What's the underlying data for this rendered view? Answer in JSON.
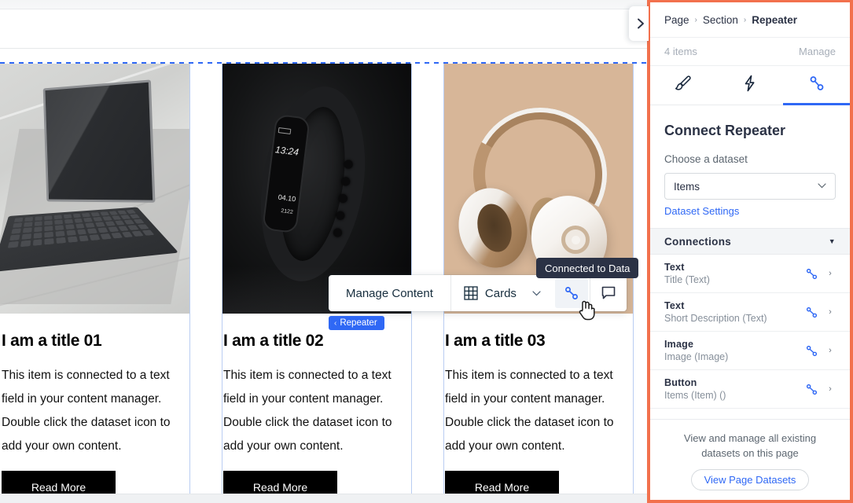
{
  "canvas": {
    "selection_label": "Repeater",
    "selection_chevron": "‹",
    "collapse_icon": "chevron-right",
    "cards": [
      {
        "image": "tablet-with-keyboard",
        "title": "I am a title 01",
        "text": "This item is connected to a text field in your content manager. Double click the dataset icon to add your own content.",
        "button": "Read More"
      },
      {
        "image": "black-fitness-tracker",
        "image_texts": {
          "time": "13:24",
          "date": "04.10",
          "steps": "2122"
        },
        "title": "I am a title 02",
        "text": "This item is connected to a text field in your content manager. Double click the dataset icon to add your own content.",
        "button": "Read More"
      },
      {
        "image": "gold-white-headphones",
        "title": "I am a title 03",
        "text": "This item is connected to a text field in your content manager. Double click the dataset icon to add your own content.",
        "button": "Read More"
      }
    ]
  },
  "toolbar": {
    "manage_content": "Manage Content",
    "layout_label": "Cards",
    "layout_icon": "grid-icon",
    "dropdown_chevron": "⌄",
    "connect_icon": "connect-data-icon",
    "comment_icon": "comment-icon",
    "tooltip": "Connected to Data"
  },
  "panel": {
    "breadcrumb": {
      "page": "Page",
      "section": "Section",
      "current": "Repeater",
      "separator": "›"
    },
    "items_count": "4 items",
    "manage": "Manage",
    "tabs": [
      {
        "name": "design",
        "icon": "brush-icon",
        "active": false
      },
      {
        "name": "interactions",
        "icon": "lightning-icon",
        "active": false
      },
      {
        "name": "connect-data",
        "icon": "connect-data-icon",
        "active": true
      }
    ],
    "title": "Connect Repeater",
    "choose_label": "Choose a dataset",
    "dataset_value": "Items",
    "dataset_chevron": "⌄",
    "dataset_settings_link": "Dataset Settings",
    "connections_header": "Connections",
    "connections_caret": "▼",
    "connections": [
      {
        "type": "Text",
        "field": "Title (Text)",
        "icon": "connect-data-icon",
        "arrow": "›"
      },
      {
        "type": "Text",
        "field": "Short Description (Text)",
        "icon": "connect-data-icon",
        "arrow": "›"
      },
      {
        "type": "Image",
        "field": "Image (Image)",
        "icon": "connect-data-icon",
        "arrow": "›"
      },
      {
        "type": "Button",
        "field": "Items (Item) ()",
        "icon": "connect-data-icon",
        "arrow": "›"
      }
    ],
    "footer_text": "View and manage all existing datasets on this page",
    "footer_button": "View Page Datasets"
  },
  "colors": {
    "accent_blue": "#2f68f5",
    "panel_highlight": "#f2714d",
    "tooltip_bg": "#2b3245",
    "text_dark": "#2b3245",
    "text_muted": "#868f9a"
  }
}
